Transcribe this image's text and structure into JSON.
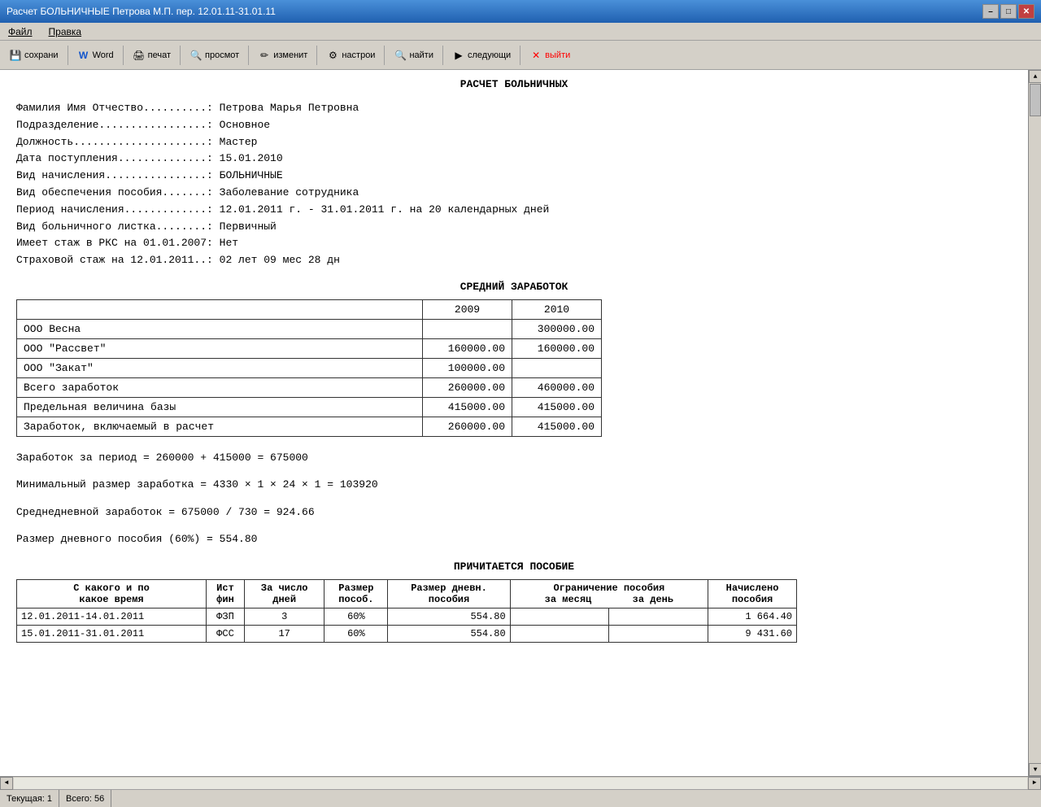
{
  "titleBar": {
    "title": "Расчет БОЛЬНИЧНЫЕ Петрова М.П. пер. 12.01.11-31.01.11",
    "minimize": "–",
    "maximize": "□",
    "close": "✕"
  },
  "menuBar": {
    "items": [
      "Файл",
      "Правка"
    ]
  },
  "toolbar": {
    "buttons": [
      {
        "name": "save-button",
        "icon": "💾",
        "label": "сохрани"
      },
      {
        "name": "word-button",
        "icon": "W",
        "label": "Word"
      },
      {
        "name": "print-button",
        "icon": "🖨",
        "label": "печат"
      },
      {
        "name": "preview-button",
        "icon": "🔍",
        "label": "просмот"
      },
      {
        "name": "edit-button",
        "icon": "✏",
        "label": "изменит"
      },
      {
        "name": "settings-button",
        "icon": "⚙",
        "label": "настрои"
      },
      {
        "name": "find-button",
        "icon": "🔍",
        "label": "найти"
      },
      {
        "name": "next-button",
        "icon": "▶",
        "label": "следующи"
      },
      {
        "name": "exit-button",
        "icon": "✕",
        "label": "выйти"
      }
    ]
  },
  "document": {
    "title": "РАСЧЕТ БОЛЬНИЧНЫХ",
    "infoLines": [
      "Фамилия Имя Отчество..........: Петрова Марья Петровна",
      "Подразделение.................: Основное",
      "Должность.....................: Мастер",
      "Дата поступления..............: 15.01.2010",
      "Вид начисления................: БОЛЬНИЧНЫЕ",
      "Вид обеспечения пособия.......: Заболевание сотрудника",
      "Период начисления.............: 12.01.2011 г. - 31.01.2011 г. на 20 календарных дней",
      "Вид больничного листка........: Первичный",
      "Имеет стаж в РКС на 01.01.2007: Нет",
      "Страховой стаж на 12.01.2011..: 02 лет 09 мес 28 дн"
    ],
    "earningsTitle": "СРЕДНИЙ   ЗАРАБОТОК",
    "earningsTable": {
      "headers": [
        "",
        "2009",
        "2010"
      ],
      "rows": [
        {
          "label": "ООО Весна",
          "y2009": "",
          "y2010": "300000.00"
        },
        {
          "label": "ООО \"Рассвет\"",
          "y2009": "160000.00",
          "y2010": "160000.00"
        },
        {
          "label": "ООО \"Закат\"",
          "y2009": "100000.00",
          "y2010": ""
        }
      ],
      "totals": [
        {
          "label": "Всего заработок",
          "y2009": "260000.00",
          "y2010": "460000.00"
        },
        {
          "label": "Предельная величина базы",
          "y2009": "415000.00",
          "y2010": "415000.00"
        },
        {
          "label": "Заработок, включаемый в расчет",
          "y2009": "260000.00",
          "y2010": "415000.00"
        }
      ]
    },
    "calcLines": [
      "Заработок за период = 260000 + 415000 = 675000",
      "Минимальный размер заработка = 4330 × 1 × 24 × 1 = 103920",
      "Среднедневной заработок   = 675000 / 730 = 924.66",
      "Размер дневного пособия (60%) = 554.80"
    ],
    "payoutTitle": "ПРИЧИТАЕТСЯ ПОСОБИЕ",
    "payoutTable": {
      "headers": [
        "С какого и по\nкакое время",
        "Ист\nфин",
        "За число\nдней",
        "Размер\nпособ.",
        "Размер дневн.\nпособия",
        "Ограничение пособия\nза месяц      за день",
        "Начислено\nпособия"
      ],
      "rows": [
        {
          "period": "12.01.2011-14.01.2011",
          "source": "ФЗП",
          "days": "3",
          "size": "60%",
          "daily": "554.80",
          "limitMonth": "",
          "limitDay": "",
          "accrued": "1 664.40"
        },
        {
          "period": "15.01.2011-31.01.2011",
          "source": "ФСС",
          "days": "17",
          "size": "60%",
          "daily": "554.80",
          "limitMonth": "",
          "limitDay": "",
          "accrued": "9 431.60"
        }
      ]
    }
  },
  "statusBar": {
    "current": "Текущая: 1",
    "total": "Всего: 56"
  }
}
